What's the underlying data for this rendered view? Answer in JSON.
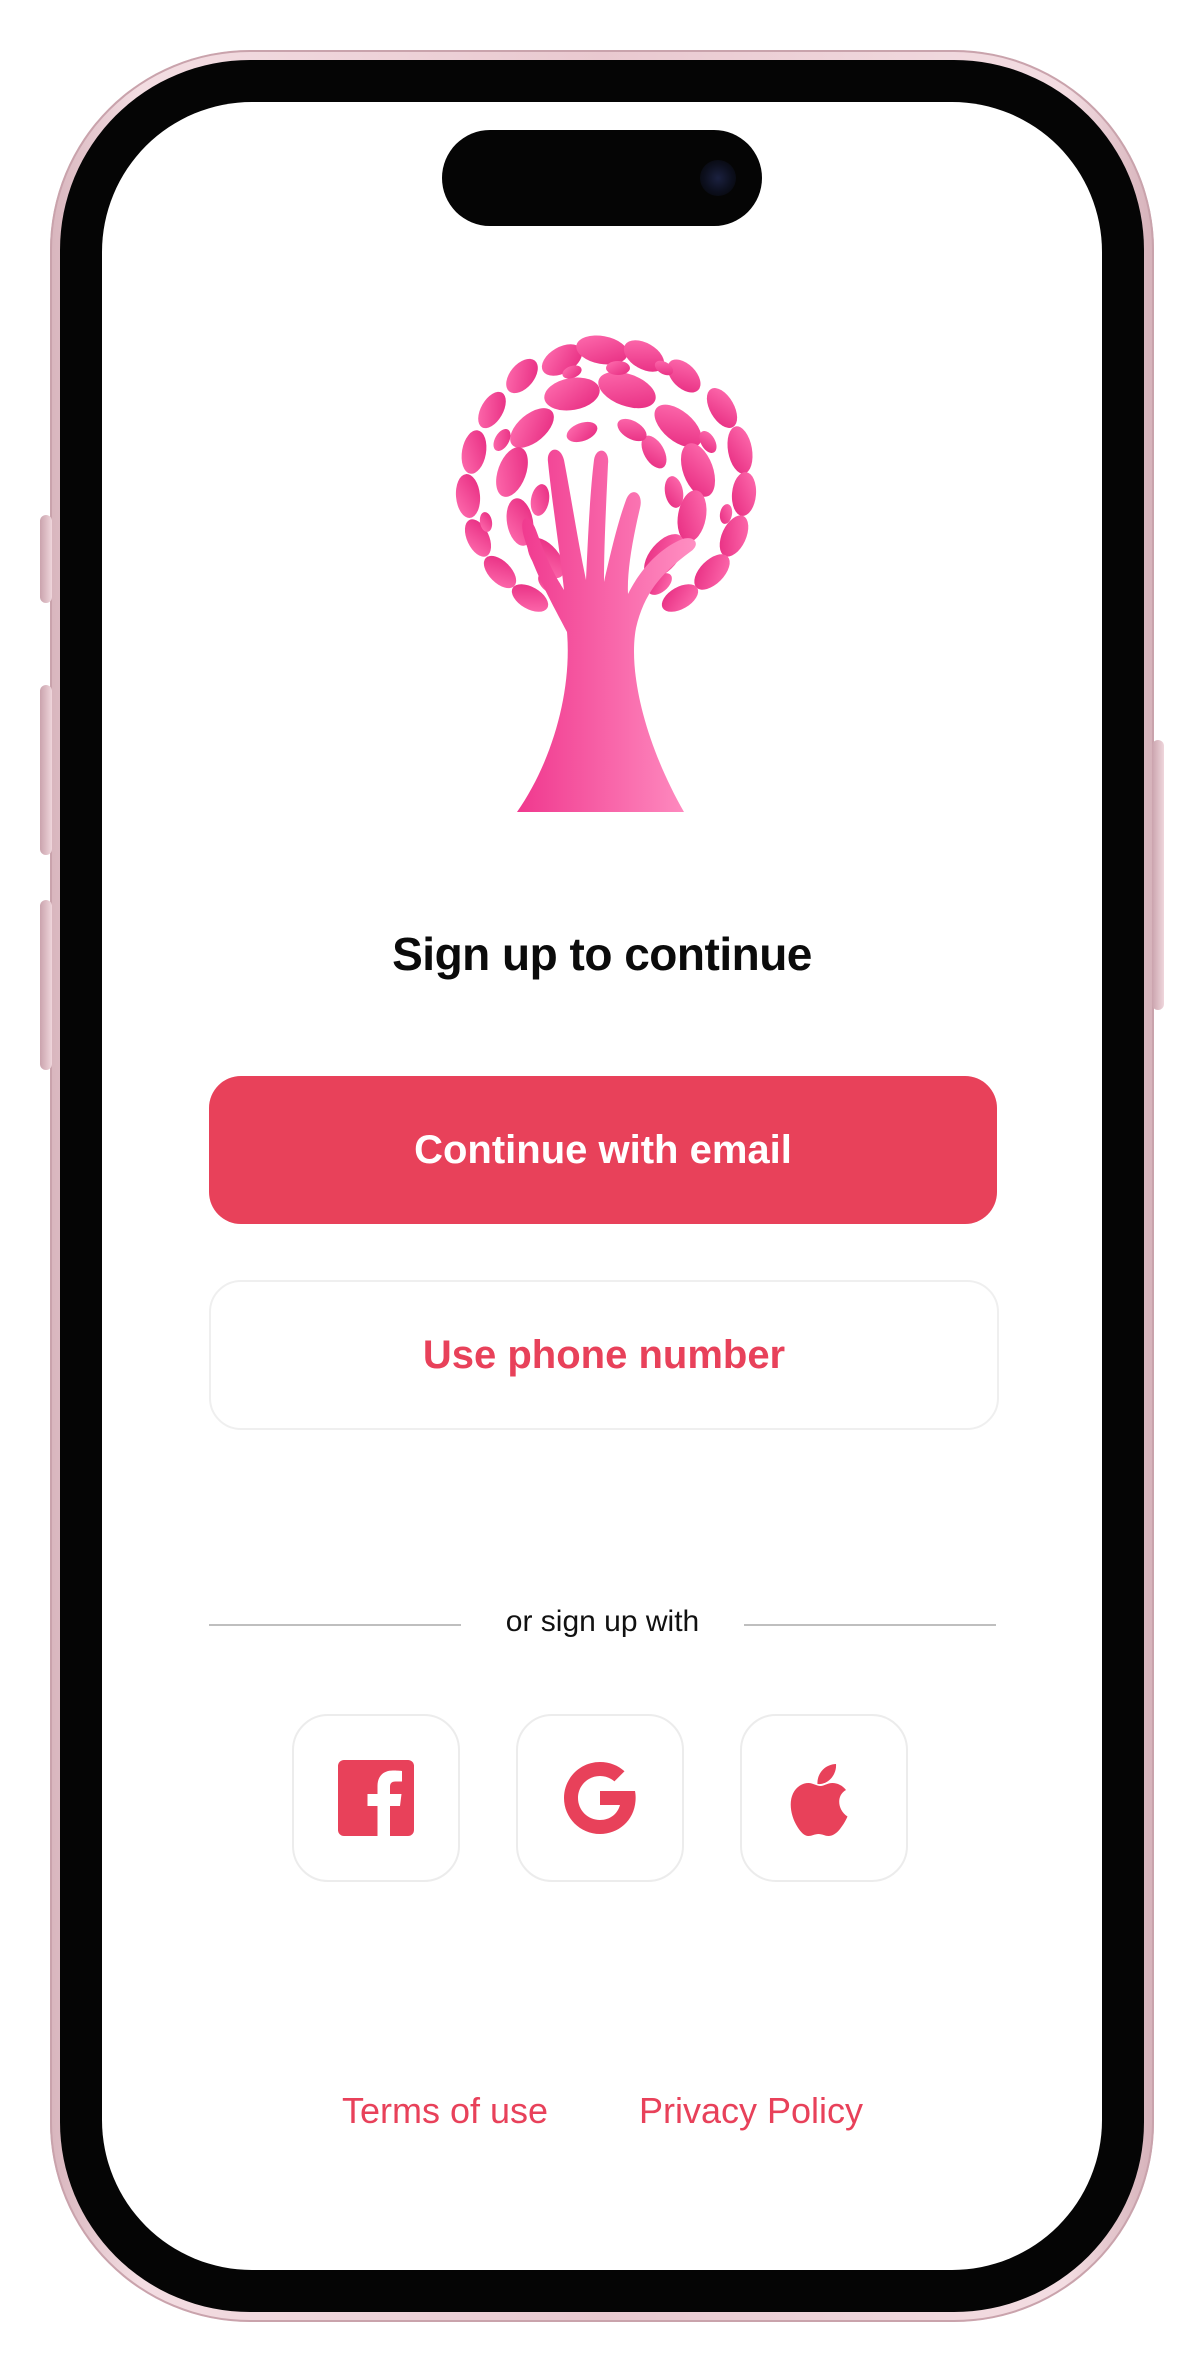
{
  "colors": {
    "accent": "#e8415a",
    "logo_pink": "#f0388e",
    "logo_pink_light": "#ff7ab8",
    "text": "#0b0b0b",
    "divider": "#bfbfbf",
    "tile_border": "#ececec"
  },
  "logo": {
    "icon": "tree-hand-logo"
  },
  "auth": {
    "title": "Sign up to continue",
    "primary_button": "Continue with email",
    "secondary_button": "Use phone number",
    "divider_text": "or sign up with",
    "social": [
      {
        "name": "Facebook",
        "icon": "facebook-icon"
      },
      {
        "name": "Google",
        "icon": "google-icon"
      },
      {
        "name": "Apple",
        "icon": "apple-icon"
      }
    ]
  },
  "footer": {
    "terms": "Terms of use",
    "privacy": "Privacy Policy"
  }
}
